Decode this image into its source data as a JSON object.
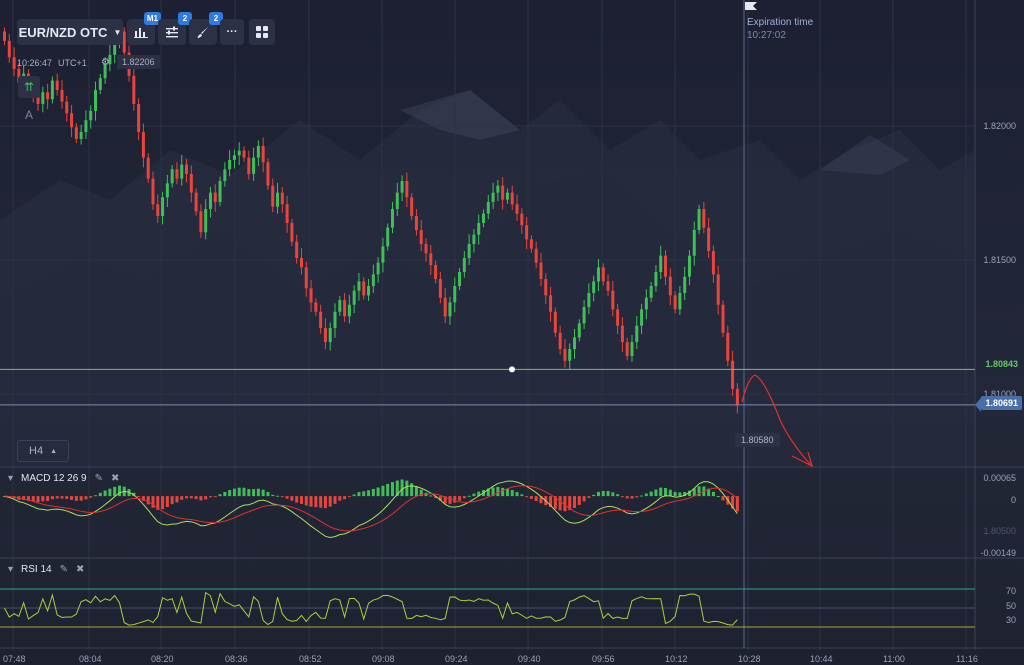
{
  "toolbar": {
    "pair": "EUR/NZD OTC",
    "chart_type_badge": "M1",
    "indicators_badge": "2",
    "drawings_badge": "2",
    "more_label": "···"
  },
  "clock": {
    "time": "10:26:47",
    "timezone": "UTC+1"
  },
  "current_price_chip": "1.82206",
  "side": {
    "up_icon": "⇈",
    "auto_label": "A"
  },
  "timeframe": {
    "label": "H4"
  },
  "expiration": {
    "label": "Expiration time",
    "time": "10:27:02"
  },
  "price_axis": {
    "labels": [
      "1.82000",
      "1.81500",
      "1.81000"
    ]
  },
  "markers": {
    "strike_price": "1.80843",
    "current_price": "1.80691",
    "min_price": "1.80580"
  },
  "time_axis": {
    "labels": [
      "07:48",
      "08:04",
      "08:20",
      "08:36",
      "08:52",
      "09:08",
      "09:24",
      "09:40",
      "09:56",
      "10:12",
      "10:28",
      "10:44",
      "11:00",
      "11:16"
    ]
  },
  "macd": {
    "title": "MACD  12 26 9",
    "axis": [
      "0.00065",
      "0",
      "1.80500",
      "-0.00149"
    ]
  },
  "rsi": {
    "title": "RSI  14",
    "axis": [
      "70",
      "50",
      "30"
    ]
  },
  "colors": {
    "bull": "#3fbf5a",
    "bear": "#e8453c",
    "strike_line": "#6cc46c",
    "price_line": "#7d8bb0",
    "price_flag": "#4a6fa8",
    "annotation": "#e8302a",
    "macd_line": "#a7e05a",
    "signal_line": "#e03030",
    "rsi_line": "#a7d23c",
    "rsi_band_top": "#2fa58f",
    "rsi_band_bottom": "#b5a03a"
  },
  "chart_data": {
    "type": "candlestick",
    "price_range": [
      1.80425,
      1.82425
    ],
    "candles_close": [
      1.8225,
      1.8218,
      1.8213,
      1.8207,
      1.8211,
      1.8205,
      1.8201,
      1.8198,
      1.8203,
      1.82,
      1.8208,
      1.8204,
      1.8199,
      1.8194,
      1.8188,
      1.8183,
      1.8186,
      1.8191,
      1.8195,
      1.8204,
      1.8209,
      1.8215,
      1.8219,
      1.8226,
      1.8229,
      1.822,
      1.821,
      1.8198,
      1.8186,
      1.8175,
      1.8166,
      1.8155,
      1.815,
      1.8158,
      1.8164,
      1.817,
      1.8166,
      1.8172,
      1.8168,
      1.816,
      1.8152,
      1.8143,
      1.8153,
      1.816,
      1.8156,
      1.8165,
      1.817,
      1.8174,
      1.8176,
      1.8178,
      1.8175,
      1.8168,
      1.8175,
      1.818,
      1.8173,
      1.8163,
      1.8154,
      1.816,
      1.8155,
      1.8147,
      1.8139,
      1.8132,
      1.8128,
      1.8119,
      1.8113,
      1.8109,
      1.8102,
      1.8096,
      1.8102,
      1.8109,
      1.8114,
      1.8107,
      1.8112,
      1.8118,
      1.8122,
      1.8116,
      1.812,
      1.8125,
      1.813,
      1.8137,
      1.8145,
      1.8153,
      1.816,
      1.8165,
      1.8158,
      1.815,
      1.8144,
      1.8138,
      1.8134,
      1.8129,
      1.8123,
      1.8115,
      1.8107,
      1.8113,
      1.812,
      1.8126,
      1.8132,
      1.8138,
      1.8142,
      1.8147,
      1.8151,
      1.8156,
      1.816,
      1.8163,
      1.8157,
      1.816,
      1.8155,
      1.8151,
      1.8146,
      1.814,
      1.8136,
      1.813,
      1.8123,
      1.8116,
      1.8109,
      1.81,
      1.8093,
      1.8088,
      1.8093,
      1.8098,
      1.8104,
      1.8111,
      1.8117,
      1.8122,
      1.8128,
      1.8122,
      1.8118,
      1.811,
      1.8103,
      1.8096,
      1.809,
      1.8096,
      1.8103,
      1.811,
      1.8115,
      1.812,
      1.8126,
      1.8133,
      1.8124,
      1.8116,
      1.811,
      1.8117,
      1.8124,
      1.8133,
      1.8144,
      1.8153,
      1.8145,
      1.8135,
      1.8125,
      1.8112,
      1.81,
      1.8088,
      1.8076,
      1.8069
    ],
    "expiry_time": "10:27:02",
    "strike_price": 1.80843,
    "current_price": 1.80691,
    "macd_range": [
      -0.00149,
      0.00065
    ],
    "rsi_levels": [
      70,
      50,
      30
    ]
  }
}
